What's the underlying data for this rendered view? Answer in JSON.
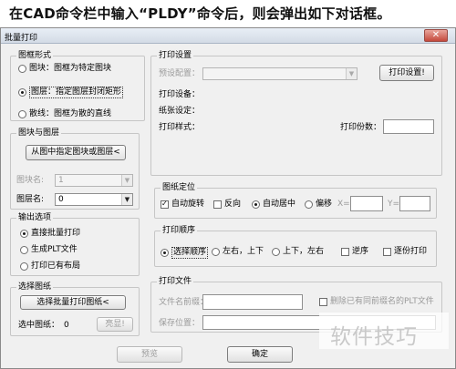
{
  "caption": "在CAD命令栏中输入“PLDY”命令后，则会弹出如下对话框。",
  "window": {
    "title": "批量打印",
    "close_glyph": "✕"
  },
  "frame_shape": {
    "label": "图框形式",
    "options": [
      "图块：图框为特定图块",
      "图层：指定图层封闭矩形",
      "散线：图框为散的直线"
    ],
    "selected_index": 1
  },
  "block_layer": {
    "label": "图块与图层",
    "pick_button": "从图中指定图块或图层<",
    "block_name_label": "图块名:",
    "block_name_value": "1",
    "layer_name_label": "图层名:",
    "layer_name_value": "0"
  },
  "output_options": {
    "label": "输出选项",
    "options": [
      "直接批量打印",
      "生成PLT文件",
      "打印已有布局"
    ],
    "selected_index": 0
  },
  "select_drawings": {
    "label": "选择图纸",
    "select_button": "选择批量打印图纸<",
    "selected_label": "选中图纸：",
    "selected_count": "0",
    "highlight_button": "亮显!"
  },
  "print_settings": {
    "label": "打印设置",
    "preset_label": "预设配置：",
    "preset_value": "",
    "settings_button": "打印设置!",
    "device_label": "打印设备：",
    "paper_label": "纸张设定：",
    "style_label": "打印样式：",
    "copies_label": "打印份数：",
    "copies_value": ""
  },
  "frame_position": {
    "label": "图纸定位",
    "auto_rotate": "自动旋转",
    "reverse": "反向",
    "auto_center": "自动居中",
    "offset": "偏移",
    "x_label": "X=",
    "y_label": "Y=",
    "x_value": "",
    "y_value": ""
  },
  "print_order": {
    "label": "打印顺序",
    "options": [
      "选择顺序",
      "左右，上下",
      "上下，左右"
    ],
    "selected_index": 0,
    "reverse_order": "逆序",
    "reverse_print": "逐份打印"
  },
  "print_file": {
    "label": "打印文件",
    "prefix_label": "文件名前缀：",
    "prefix_value": "",
    "delete_same_prefix": "删除已有同前缀名的PLT文件",
    "save_location_label": "保存位置：",
    "save_location_value": ""
  },
  "footer": {
    "preview": "预览",
    "ok": "确定"
  },
  "watermark": "软件技巧"
}
